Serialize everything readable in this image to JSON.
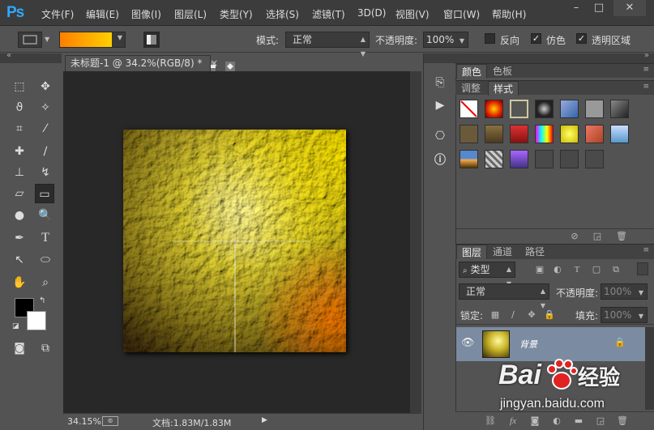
{
  "menu": {
    "logo": "Ps",
    "items": [
      "文件(F)",
      "编辑(E)",
      "图像(I)",
      "图层(L)",
      "类型(Y)",
      "选择(S)",
      "滤镜(T)",
      "3D(D)",
      "视图(V)",
      "窗口(W)",
      "帮助(H)"
    ],
    "win_minimize": "–",
    "win_restore": "□",
    "win_close": "✕"
  },
  "options": {
    "mode_label": "模式:",
    "mode_value": "正常",
    "opacity_label": "不透明度:",
    "opacity_value": "100%",
    "reverse_label": "反向",
    "dither_label": "仿色",
    "transparency_label": "透明区域",
    "reverse_checked": "",
    "dither_checked": "✓",
    "transparency_checked": "✓",
    "gradient_colors": [
      "#ff7f00",
      "#ffd000"
    ]
  },
  "document": {
    "tab_title": "未标题-1 @ 34.2%(RGB/8) *",
    "tab_close": "×",
    "zoom": "34.15%",
    "doc_info": "文档:1.83M/1.83M"
  },
  "panels": {
    "top_tabs": [
      "颜色",
      "色板"
    ],
    "style_tabs": [
      "调整",
      "样式"
    ],
    "layer_tabs": [
      "图层",
      "通道",
      "路径"
    ],
    "kind_filter": "类型",
    "blend_mode": "正常",
    "opacity_label": "不透明度:",
    "opacity_value": "100%",
    "lock_label": "锁定:",
    "fill_label": "填充:",
    "fill_value": "100%",
    "layer_name": "背景"
  },
  "watermark": {
    "brand": "Bai",
    "brand_cn": "经验",
    "url": "jingyan.baidu.com"
  },
  "colors": {
    "foreground": "#000000",
    "background": "#ffffff",
    "accent": "#31a8ff",
    "layer_selected": "#7b8ba1"
  }
}
